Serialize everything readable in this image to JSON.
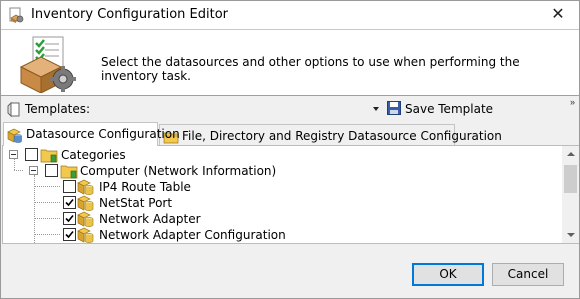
{
  "window": {
    "title": "Inventory Configuration Editor",
    "close_label": "✕"
  },
  "header": {
    "description": "Select the datasources and other options to use when performing the inventory task."
  },
  "templates": {
    "label": "Templates:",
    "value": "",
    "save_label": "Save Template",
    "overflow_label": "»"
  },
  "tabs": [
    {
      "label": "Datasource Configuration",
      "active": true
    },
    {
      "label": "File, Directory and Registry Datasource Configuration",
      "active": false
    }
  ],
  "tree": {
    "root": {
      "label": "Categories",
      "checked": false
    },
    "group": {
      "label": "Computer (Network Information)",
      "checked": false
    },
    "items": [
      {
        "label": "IP4 Route Table",
        "checked": false
      },
      {
        "label": "NetStat Port",
        "checked": true
      },
      {
        "label": "Network Adapter",
        "checked": true
      },
      {
        "label": "Network Adapter Configuration",
        "checked": true
      }
    ]
  },
  "buttons": {
    "ok": "OK",
    "cancel": "Cancel"
  },
  "icon_names": {
    "title": "inventory-config-icon",
    "header": "inventory-box-gear-icon",
    "templates": "template-icon",
    "save": "floppy-disk-icon",
    "folder": "folder-icon",
    "datasource": "datasource-cylinder-icon"
  },
  "colors": {
    "accent": "#0078d7",
    "folder": "#f2c94c",
    "check_green": "#2e9e3a"
  }
}
